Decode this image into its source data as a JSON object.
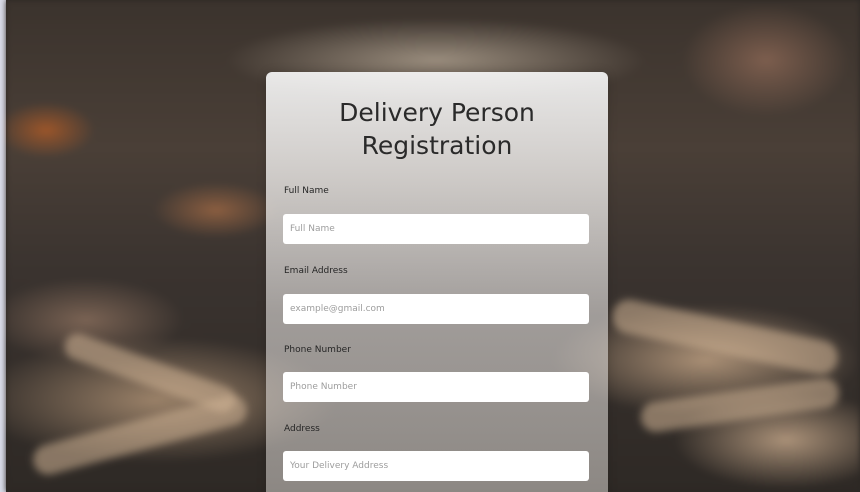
{
  "form": {
    "title_line1": "Delivery Person",
    "title_line2": "Registration",
    "full_name": {
      "label": "Full Name",
      "value": "",
      "placeholder": "Full Name"
    },
    "email": {
      "label": "Email Address",
      "value": "",
      "placeholder": "example@gmail.com"
    },
    "phone": {
      "label": "Phone Number",
      "value": "",
      "placeholder": "Phone Number"
    },
    "address": {
      "label": "Address",
      "value": "",
      "placeholder": "Your Delivery Address"
    }
  },
  "colors": {
    "card_bg": "#f2f2f2",
    "text": "#2a2a2a",
    "input_bg": "#ffffff",
    "placeholder": "#9d9d9d"
  }
}
